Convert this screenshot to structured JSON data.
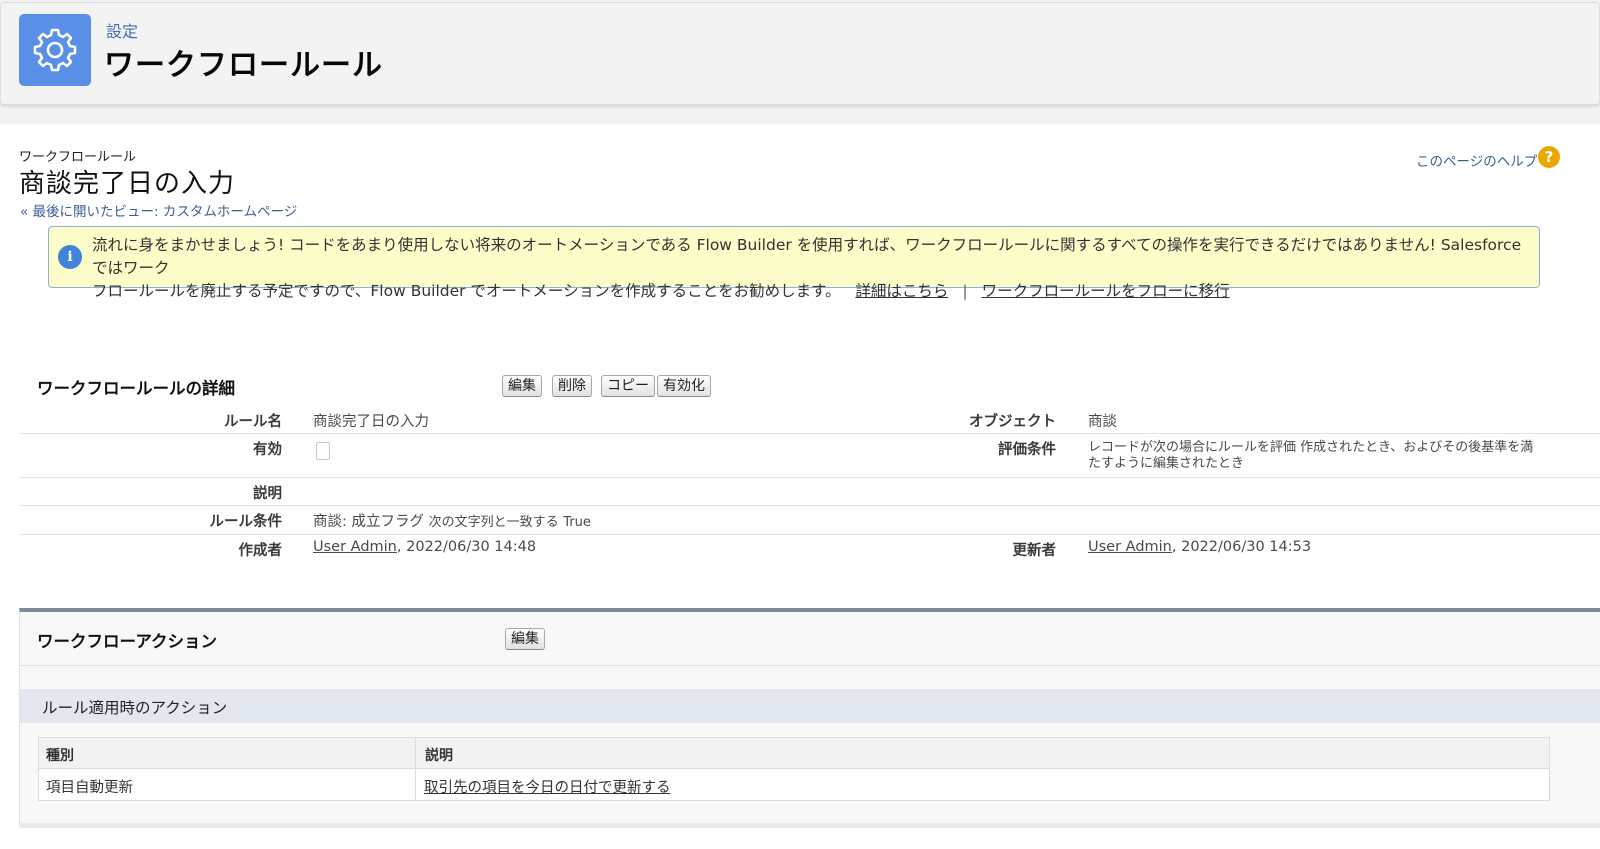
{
  "header": {
    "crumb": "設定",
    "title": "ワークフロールール"
  },
  "page": {
    "type_label": "ワークフロールール",
    "rule_name": "商談完了日の入力",
    "back_link": "« 最後に開いたビュー: カスタムホームページ",
    "help_link": "このページのヘルプ",
    "help_icon": "?"
  },
  "banner": {
    "icon": "i",
    "line1": "流れに身をまかせましょう! コードをあまり使用しない将来のオートメーションである Flow Builder を使用すれば、ワークフロールールに関するすべての操作を実行できるだけではありません! Salesforce ではワーク",
    "line2": "フロールールを廃止する予定ですので、Flow Builder でオートメーションを作成することをお勧めします。",
    "learn_more": "詳細はこちら",
    "separator": "|",
    "migrate_link": "ワークフロールールをフローに移行"
  },
  "detail": {
    "title": "ワークフロールールの詳細",
    "buttons": {
      "edit": "編集",
      "delete": "削除",
      "copy": "コピー",
      "activate": "有効化"
    },
    "fields": {
      "rule_name_label": "ルール名",
      "rule_name_value": "商談完了日の入力",
      "object_label": "オブジェクト",
      "object_value": "商談",
      "active_label": "有効",
      "eval_label": "評価条件",
      "eval_value_1": "レコードが次の場合にルールを評価 作成されたとき、およびその後基準を満",
      "eval_value_2": "たすように編集されたとき",
      "desc_label": "説明",
      "criteria_label": "ルール条件",
      "criteria_field": "商談: 成立フラグ",
      "criteria_op": "次の文字列と一致する",
      "criteria_val": "True",
      "created_label": "作成者",
      "created_user": "User Admin",
      "created_date": ", 2022/06/30 14:48",
      "modified_label": "更新者",
      "modified_user": "User Admin",
      "modified_date": ", 2022/06/30 14:53"
    }
  },
  "actions": {
    "title": "ワークフローアクション",
    "edit": "編集",
    "subsection": "ルール適用時のアクション",
    "columns": [
      "種別",
      "説明"
    ],
    "rows": [
      {
        "type": "項目自動更新",
        "description": "取引先の項目を今日の日付で更新する"
      }
    ]
  },
  "colors": {
    "setup_icon_bg": "#5a8fe8",
    "banner_bg": "#fdfdc9",
    "help_icon": "#e8a800",
    "info_icon": "#3f84d6"
  },
  "icons": {
    "setup": "gear-icon",
    "help": "help-icon",
    "info": "info-icon"
  }
}
